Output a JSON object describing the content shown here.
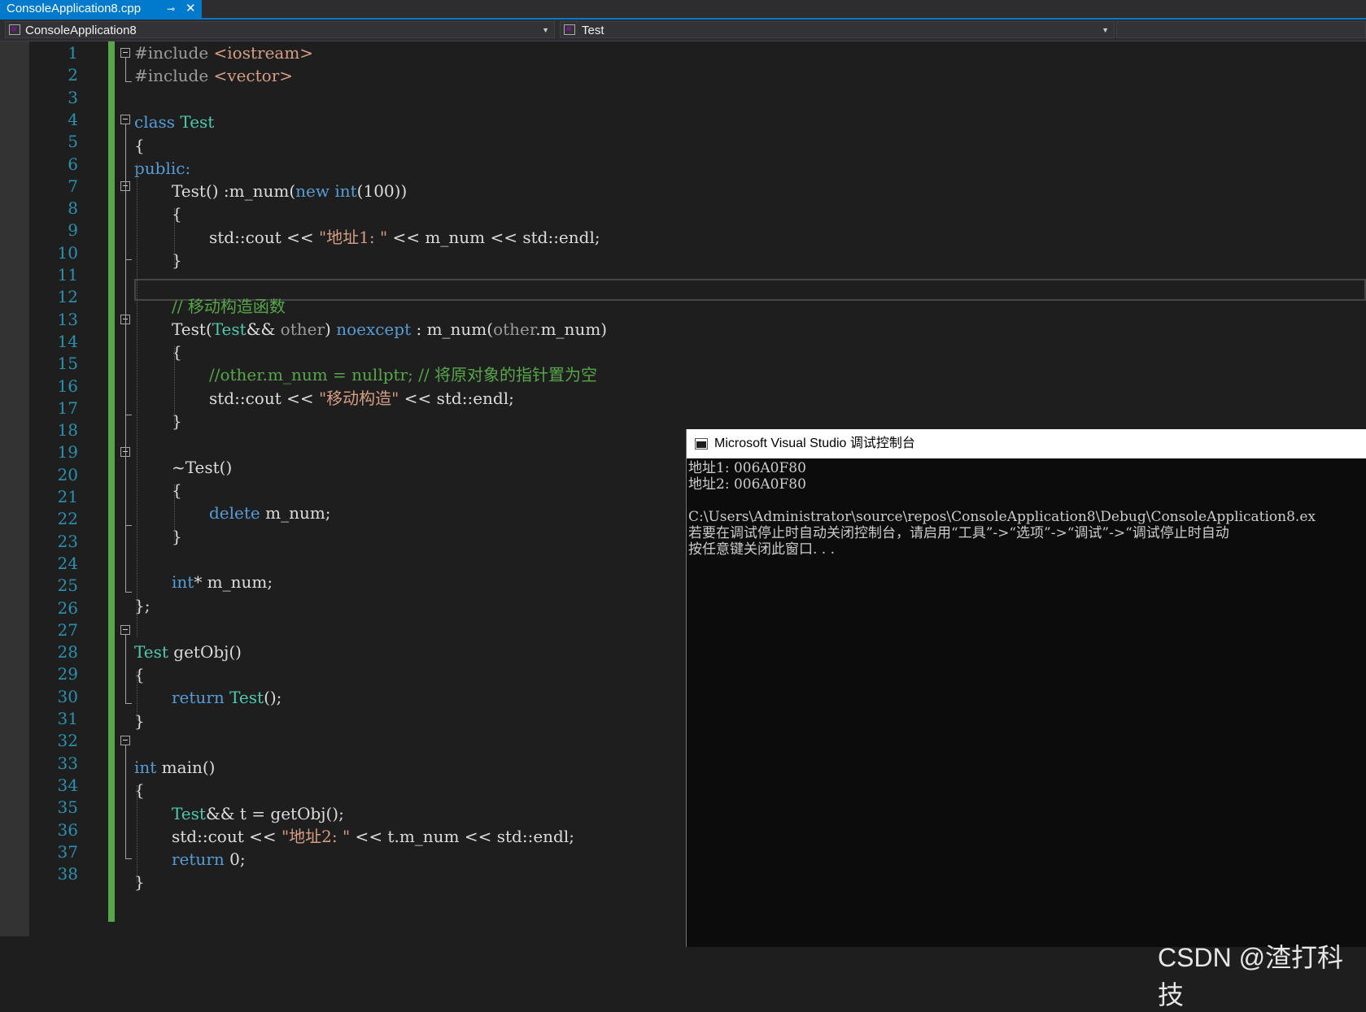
{
  "tab": {
    "title": "ConsoleApplication8.cpp",
    "pin_glyph": "⊸",
    "close_glyph": "✕"
  },
  "navbar": {
    "project": "ConsoleApplication8",
    "member": "Test",
    "caret": "▼"
  },
  "line_numbers": [
    "1",
    "2",
    "3",
    "4",
    "5",
    "6",
    "7",
    "8",
    "9",
    "10",
    "11",
    "12",
    "13",
    "14",
    "15",
    "16",
    "17",
    "18",
    "19",
    "20",
    "21",
    "22",
    "23",
    "24",
    "25",
    "26",
    "27",
    "28",
    "29",
    "30",
    "31",
    "32",
    "33",
    "34",
    "35",
    "36",
    "37",
    "38"
  ],
  "code": {
    "l1": {
      "pp": "#include ",
      "lib": "<iostream>"
    },
    "l2": {
      "pp": "#include ",
      "lib": "<vector>"
    },
    "l4": {
      "kw": "class",
      "ty": "Test"
    },
    "l5": "{",
    "l6": "public:",
    "l7": {
      "name": "Test",
      "sig": "() :m_num(",
      "kw1": "new",
      "kw2": "int",
      "args": "(100))"
    },
    "l8": "{",
    "l9": {
      "a": "std::cout << ",
      "str": "\"地址1: \"",
      "b": " << m_num << std::endl;"
    },
    "l10": "}",
    "l12": "// 移动构造函数",
    "l13": {
      "name": "Test",
      "p1": "(",
      "ty": "Test",
      "amp": "&& ",
      "param": "other",
      "p2": ") ",
      "kw": "noexcept",
      "init": " : m_num(",
      "param2": "other",
      "tail": ".m_num)"
    },
    "l14": "{",
    "l15": "//other.m_num = nullptr; // 将原对象的指针置为空",
    "l16": {
      "a": "std::cout << ",
      "str": "\"移动构造\"",
      "b": " << std::endl;"
    },
    "l17": "}",
    "l19": "~Test()",
    "l20": "{",
    "l21": {
      "kw": "delete",
      "rest": " m_num;"
    },
    "l22": "}",
    "l24": {
      "kw": "int",
      "rest": "* m_num;"
    },
    "l25": "};",
    "l27": {
      "ty": "Test",
      "rest": " getObj()"
    },
    "l28": "{",
    "l29": {
      "kw": "return",
      "ty": "Test",
      "rest": "();"
    },
    "l30": "}",
    "l32": {
      "kw": "int",
      "rest": " main()"
    },
    "l33": "{",
    "l34": {
      "ty": "Test",
      "rest": "&& t = getObj();"
    },
    "l35": {
      "a": "std::cout << ",
      "str": "\"地址2: \"",
      "b": " << t.m_num << std::endl;"
    },
    "l36": {
      "kw": "return",
      "rest": " 0;"
    },
    "l37": "}"
  },
  "console": {
    "title": "Microsoft Visual Studio 调试控制台",
    "lines": [
      "地址1: 006A0F80",
      "地址2: 006A0F80",
      "",
      "C:\\Users\\Administrator\\source\\repos\\ConsoleApplication8\\Debug\\ConsoleApplication8.ex",
      "若要在调试停止时自动关闭控制台，请启用“工具”->“选项”->“调试”->“调试停止时自动",
      "按任意键关闭此窗口. . ."
    ]
  },
  "watermark": "CSDN @渣打科技",
  "colors": {
    "accent": "#007acc",
    "keyword": "#569cd6",
    "type": "#4ec9b0",
    "string": "#d69d85",
    "comment": "#57a64a",
    "line_number": "#2b91af",
    "change_bar": "#57a64a"
  }
}
